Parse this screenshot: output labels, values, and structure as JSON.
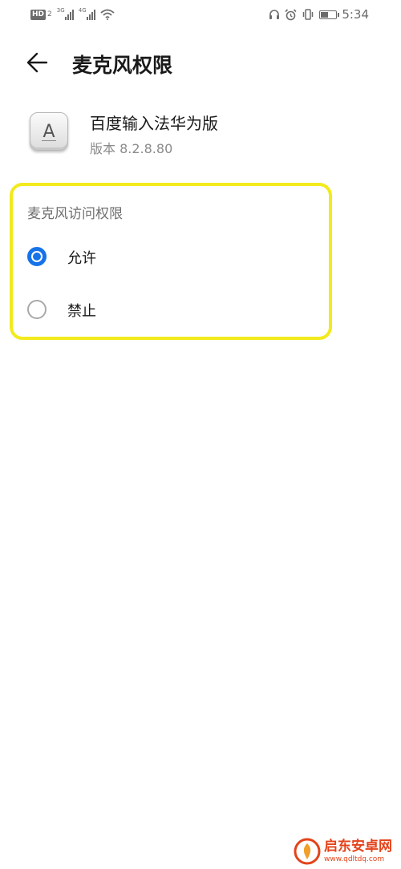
{
  "status_bar": {
    "hd_badge": "HD",
    "hd_sub": "2",
    "network_1": "3G",
    "network_2": "4G",
    "time": "5:34",
    "battery_level_percent": 50,
    "icons": [
      "headset-icon",
      "alarm-icon",
      "vibrate-icon",
      "battery-icon",
      "wifi-icon"
    ]
  },
  "header": {
    "back_icon": "arrow-left-icon",
    "title": "麦克风权限"
  },
  "app": {
    "icon": "keyboard-key-a-icon",
    "icon_letter": "A",
    "name": "百度输入法华为版",
    "version": "版本 8.2.8.80"
  },
  "permission": {
    "section_title": "麦克风访问权限",
    "options": [
      {
        "label": "允许",
        "selected": true
      },
      {
        "label": "禁止",
        "selected": false
      }
    ]
  },
  "watermark": {
    "name": "启东安卓网",
    "url": "www.qdltdq.com"
  },
  "colors": {
    "accent": "#1672e8",
    "highlight": "#f2ea1d",
    "watermark": "#e4431a"
  }
}
